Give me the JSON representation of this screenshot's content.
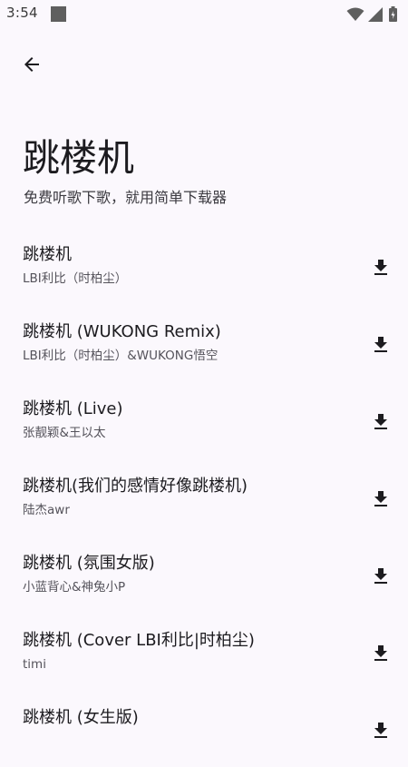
{
  "status_bar": {
    "time": "3:54",
    "icons": [
      "notification-square-icon",
      "wifi-icon",
      "cellular-signal-icon",
      "battery-icon"
    ]
  },
  "header": {
    "back_icon": "arrow-left-icon",
    "title": "跳楼机",
    "subtitle": "免费听歌下歌，就用简单下载器"
  },
  "songs": [
    {
      "title": "跳楼机",
      "artist": "LBI利比（时柏尘）",
      "action_icon": "download-icon"
    },
    {
      "title": "跳楼机 (WUKONG Remix)",
      "artist": "LBI利比（时柏尘）&WUKONG悟空",
      "action_icon": "download-icon"
    },
    {
      "title": "跳楼机 (Live)",
      "artist": "张靓颖&王以太",
      "action_icon": "download-icon"
    },
    {
      "title": "跳楼机(我们的感情好像跳楼机)",
      "artist": "陆杰awr",
      "action_icon": "download-icon"
    },
    {
      "title": "跳楼机 (氛围女版)",
      "artist": "小蓝背心&神兔小P",
      "action_icon": "download-icon"
    },
    {
      "title": "跳楼机 (Cover LBI利比|时柏尘)",
      "artist": "timi",
      "action_icon": "download-icon"
    },
    {
      "title": "跳楼机 (女生版)",
      "artist": "",
      "action_icon": "download-icon"
    }
  ],
  "colors": {
    "background": "#fbf8fd",
    "title_text": "#1c1b1f",
    "secondary_text": "#55535b",
    "icon": "#1c1b1f"
  }
}
